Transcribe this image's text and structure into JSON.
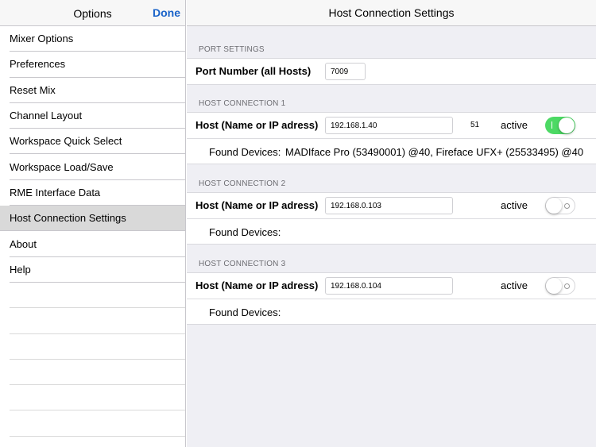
{
  "sidebar": {
    "title": "Options",
    "done_label": "Done",
    "items": [
      {
        "label": "Mixer Options"
      },
      {
        "label": "Preferences"
      },
      {
        "label": "Reset Mix"
      },
      {
        "label": "Channel Layout"
      },
      {
        "label": "Workspace Quick Select"
      },
      {
        "label": "Workspace Load/Save"
      },
      {
        "label": "RME Interface Data"
      },
      {
        "label": "Host Connection Settings"
      },
      {
        "label": "About"
      },
      {
        "label": "Help"
      }
    ],
    "selected": "Host Connection Settings"
  },
  "main": {
    "title": "Host Connection Settings",
    "port": {
      "section": "PORT SETTINGS",
      "label": "Port Number (all Hosts)",
      "value": "7009"
    },
    "hosts": [
      {
        "section": "HOST CONNECTION 1",
        "label": "Host (Name or IP adress)",
        "value": "192.168.1.40",
        "count": "51",
        "active_label": "active",
        "active": true,
        "found_label": "Found Devices:",
        "found_value": "MADIface Pro (53490001) @40, Fireface UFX+ (25533495) @40"
      },
      {
        "section": "HOST CONNECTION 2",
        "label": "Host (Name or IP adress)",
        "value": "192.168.0.103",
        "active_label": "active",
        "active": false,
        "found_label": "Found Devices:",
        "found_value": ""
      },
      {
        "section": "HOST CONNECTION 3",
        "label": "Host (Name or IP adress)",
        "value": "192.168.0.104",
        "active_label": "active",
        "active": false,
        "found_label": "Found Devices:",
        "found_value": ""
      }
    ]
  },
  "colors": {
    "accent": "#1a63c9",
    "toggle_on": "#4cd964",
    "selected_row": "#d9d9d9"
  }
}
